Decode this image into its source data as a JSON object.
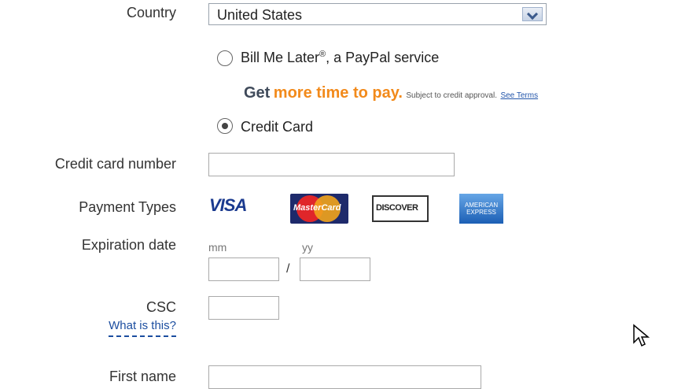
{
  "country": {
    "label": "Country",
    "selected": "United States"
  },
  "payment_options": {
    "bill_me_later": {
      "label": "Bill Me Later",
      "sup": "®",
      "suffix": ", a PayPal service"
    },
    "promo": {
      "get": "Get",
      "more": "more time to pay.",
      "note": "Subject to credit approval.",
      "terms": "See Terms"
    },
    "credit_card": {
      "label": "Credit Card"
    }
  },
  "card_number": {
    "label": "Credit card number",
    "value": ""
  },
  "payment_types": {
    "label": "Payment Types",
    "visa": "VISA",
    "mastercard": "MasterCard",
    "discover": "DISCOVER",
    "amex": "AMERICAN EXPRESS"
  },
  "expiration": {
    "label": "Expiration date",
    "mm_label": "mm",
    "yy_label": "yy",
    "separator": "/",
    "mm_value": "",
    "yy_value": ""
  },
  "csc": {
    "label": "CSC",
    "help_link": "What is this?",
    "value": ""
  },
  "first_name": {
    "label": "First name",
    "value": ""
  },
  "colors": {
    "orange": "#f28a1b",
    "link": "#1c4ea0"
  }
}
